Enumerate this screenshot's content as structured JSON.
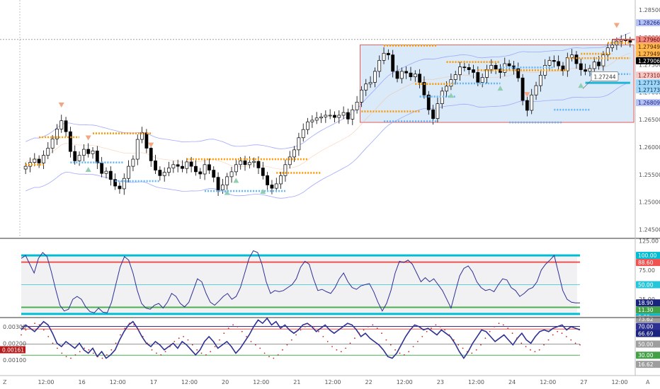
{
  "chart_data": [
    {
      "type": "candlestick",
      "panel": "price",
      "ylim": [
        1.2435,
        1.2868
      ],
      "y_ticks": [
        {
          "value": 1.285,
          "label": "1.28500"
        },
        {
          "value": 1.28,
          "label": "1.28000"
        },
        {
          "value": 1.275,
          "label": "1.27500"
        },
        {
          "value": 1.27,
          "label": "1.27000"
        },
        {
          "value": 1.265,
          "label": "1.26500"
        },
        {
          "value": 1.26,
          "label": "1.26000"
        },
        {
          "value": 1.255,
          "label": "1.25500"
        },
        {
          "value": 1.25,
          "label": "1.25000"
        },
        {
          "value": 1.245,
          "label": "1.24500"
        }
      ],
      "price_labels": [
        {
          "value": 1.28266,
          "label": "1.28266",
          "bg": "#b5c2f5",
          "fg": "#1a237e"
        },
        {
          "value": 1.2796,
          "label": "1.27960",
          "bg": "#f28b82",
          "fg": "#5a0000"
        },
        {
          "value": 1.27949,
          "label": "1.27949",
          "bg": "#ffb74d",
          "fg": "#4a2600"
        },
        {
          "value": 1.27949,
          "label": "1.27949",
          "bg": "#ffb74d",
          "fg": "#4a2600"
        },
        {
          "value": 1.27906,
          "label": "1.27906",
          "bg": "#000000",
          "fg": "#ffffff"
        },
        {
          "value": 1.2731,
          "label": "1.27310",
          "bg": "#f6c7c4",
          "fg": "#7a1010"
        },
        {
          "value": 1.27173,
          "label": "1.27173",
          "bg": "#9fd6f5",
          "fg": "#0d3b66"
        },
        {
          "value": 1.27173,
          "label": "1.27173",
          "bg": "#9fd6f5",
          "fg": "#0d3b66"
        },
        {
          "value": 1.26809,
          "label": "1.26809",
          "bg": "#b5c2f5",
          "fg": "#1a237e"
        }
      ],
      "annotation": {
        "label": "1.27244"
      },
      "rectangle": {
        "y_top": 1.2786,
        "y_bottom": 1.2645
      },
      "close": [
        1.2565,
        1.2572,
        1.2578,
        1.2571,
        1.2585,
        1.2598,
        1.2615,
        1.2633,
        1.2648,
        1.2628,
        1.2592,
        1.2575,
        1.2585,
        1.2596,
        1.2588,
        1.2593,
        1.2571,
        1.2552,
        1.2556,
        1.2541,
        1.2529,
        1.2524,
        1.2543,
        1.2565,
        1.2578,
        1.2614,
        1.2626,
        1.2598,
        1.2575,
        1.2558,
        1.2548,
        1.2554,
        1.2562,
        1.2568,
        1.2565,
        1.2561,
        1.2573,
        1.2565,
        1.2555,
        1.2551,
        1.2568,
        1.2558,
        1.2545,
        1.2522,
        1.2531,
        1.2546,
        1.2555,
        1.2568,
        1.2575,
        1.2568,
        1.2572,
        1.2574,
        1.2562,
        1.2548,
        1.2531,
        1.2525,
        1.2533,
        1.2548,
        1.2568,
        1.2582,
        1.2595,
        1.2617,
        1.2632,
        1.2646,
        1.2649,
        1.2653,
        1.2655,
        1.2658,
        1.2658,
        1.2654,
        1.2658,
        1.2663,
        1.2651,
        1.2668,
        1.2682,
        1.2704,
        1.2715,
        1.2718,
        1.2738,
        1.2758,
        1.2771,
        1.2768,
        1.2738,
        1.2725,
        1.2738,
        1.2735,
        1.2728,
        1.2733,
        1.2718,
        1.2695,
        1.2668,
        1.2652,
        1.2679,
        1.2702,
        1.2711,
        1.2723,
        1.2732,
        1.2746,
        1.2745,
        1.2741,
        1.2736,
        1.2718,
        1.2727,
        1.2741,
        1.2749,
        1.2742,
        1.2736,
        1.2752,
        1.2748,
        1.2743,
        1.2726,
        1.2685,
        1.2667,
        1.2695,
        1.2712,
        1.2731,
        1.2749,
        1.2758,
        1.2756,
        1.2748,
        1.2739,
        1.2763,
        1.2768,
        1.2752,
        1.2741,
        1.2738,
        1.2743,
        1.2755,
        1.2748,
        1.2768,
        1.2781,
        1.2786,
        1.2793,
        1.2795,
        1.2794,
        1.2791
      ]
    },
    {
      "type": "line",
      "panel": "oscillator-1",
      "ylim": [
        -5,
        128
      ],
      "y_ticks": [
        {
          "value": 125,
          "label": "125.00"
        },
        {
          "value": 75,
          "label": "75.00"
        },
        {
          "value": 50,
          "label": "50.00"
        },
        {
          "value": 25,
          "label": "25.00"
        },
        {
          "value": 0,
          "label": "0.00"
        }
      ],
      "levels": [
        {
          "value": 100,
          "color": "#00bcd4"
        },
        {
          "value": 88.6,
          "color": "#ef5350"
        },
        {
          "value": 50,
          "color": "#26c6da"
        },
        {
          "value": 11.3,
          "color": "#4caf50"
        },
        {
          "value": 0,
          "color": "#00bcd4"
        }
      ],
      "labels": [
        {
          "value": 100,
          "label": "100.00",
          "bg": "#00bcd4",
          "fg": "#ffffff"
        },
        {
          "value": 88.6,
          "label": "88.60",
          "bg": "#ef5350",
          "fg": "#ffffff"
        },
        {
          "value": 50,
          "label": "50.00",
          "bg": "#26c6da",
          "fg": "#ffffff"
        },
        {
          "value": 18.9,
          "label": "18.90",
          "bg": "#1a237e",
          "fg": "#ffffff"
        },
        {
          "value": 11.3,
          "label": "11.30",
          "bg": "#43a047",
          "fg": "#ffffff"
        },
        {
          "value": 0,
          "label": "0.00",
          "bg": "#00bcd4",
          "fg": "#ffffff"
        }
      ],
      "values": [
        95,
        100,
        85,
        70,
        95,
        105,
        98,
        72,
        42,
        15,
        5,
        8,
        25,
        30,
        25,
        12,
        4,
        2,
        10,
        3,
        2,
        20,
        50,
        80,
        98,
        92,
        70,
        40,
        18,
        10,
        8,
        15,
        18,
        10,
        20,
        35,
        30,
        18,
        12,
        20,
        40,
        60,
        55,
        35,
        20,
        15,
        22,
        30,
        35,
        25,
        30,
        45,
        70,
        95,
        108,
        105,
        85,
        55,
        35,
        40,
        38,
        40,
        45,
        50,
        60,
        80,
        90,
        85,
        60,
        40,
        42,
        38,
        35,
        45,
        60,
        70,
        55,
        45,
        42,
        48,
        50,
        52,
        38,
        20,
        5,
        18,
        40,
        70,
        90,
        88,
        92,
        85,
        70,
        55,
        62,
        55,
        60,
        50,
        40,
        25,
        10,
        38,
        65,
        78,
        82,
        72,
        55,
        45,
        40,
        42,
        38,
        50,
        60,
        58,
        45,
        40,
        30,
        35,
        42,
        45,
        55,
        75,
        85,
        92,
        100,
        70,
        40,
        25,
        20,
        19,
        18.9
      ]
    },
    {
      "type": "line",
      "panel": "oscillator-2",
      "ylim": [
        0.0001,
        0.0035
      ],
      "y_ticks": [
        {
          "value": 0.003,
          "label": "0.00300"
        },
        {
          "value": 0.002,
          "label": "0.00200"
        },
        {
          "value": 0.001,
          "label": "0.00100"
        }
      ],
      "tag": {
        "value": 0.00161,
        "label": "0.00161"
      },
      "levels": [
        {
          "value": 0.00301,
          "color": "#2e3192"
        },
        {
          "value": 0.00285,
          "color": "#ef5350"
        },
        {
          "value": 0.00195,
          "color": "#999999"
        },
        {
          "value": 0.00128,
          "color": "#4caf50"
        }
      ],
      "labels": [
        {
          "value": 0.00345,
          "label": "73.62",
          "bg": "#9e9e9e",
          "fg": "#ffffff"
        },
        {
          "value": 0.00301,
          "label": "70.00",
          "bg": "#2e3192",
          "fg": "#ffffff"
        },
        {
          "value": 0.00275,
          "label": "66.69",
          "bg": "#1a237e",
          "fg": "#ffffff"
        },
        {
          "value": 0.00195,
          "label": "50.00",
          "bg": "#9e9e9e",
          "fg": "#ffffff"
        },
        {
          "value": 0.00128,
          "label": "30.00",
          "bg": "#43a047",
          "fg": "#ffffff"
        },
        {
          "value": 0.00073,
          "label": "16.62",
          "bg": "#9e9e9e",
          "fg": "#ffffff"
        }
      ],
      "series": [
        {
          "values": [
            0.0028,
            0.0031,
            0.0029,
            0.0027,
            0.003,
            0.0033,
            0.0031,
            0.0026,
            0.002,
            0.0018,
            0.0021,
            0.0019,
            0.0017,
            0.002,
            0.0016,
            0.0014,
            0.0017,
            0.0012,
            0.0015,
            0.0011,
            0.0013,
            0.0016,
            0.0022,
            0.0027,
            0.0031,
            0.0033,
            0.0029,
            0.0024,
            0.002,
            0.0018,
            0.0021,
            0.0019,
            0.0016,
            0.0018,
            0.002,
            0.0017,
            0.0021,
            0.0019,
            0.0016,
            0.0013,
            0.0016,
            0.0021,
            0.0024,
            0.0021,
            0.0017,
            0.0019,
            0.0021,
            0.0018,
            0.0014,
            0.0017,
            0.0021,
            0.0025,
            0.003,
            0.0034,
            0.0032,
            0.0035,
            0.0031,
            0.0033,
            0.0029,
            0.0031,
            0.0028,
            0.0026,
            0.0028,
            0.0031,
            0.0032,
            0.003,
            0.0027,
            0.0029,
            0.0031,
            0.0028,
            0.0026,
            0.0028,
            0.003,
            0.0032,
            0.0031,
            0.0028,
            0.0024,
            0.0026,
            0.0023,
            0.0021,
            0.0019,
            0.0016,
            0.0012,
            0.0011,
            0.0014,
            0.0019,
            0.0024,
            0.0028,
            0.0031,
            0.003,
            0.0028,
            0.0029,
            0.0027,
            0.0025,
            0.0028,
            0.0026,
            0.0024,
            0.002,
            0.0015,
            0.0011,
            0.0015,
            0.002,
            0.0024,
            0.0028,
            0.0027,
            0.0024,
            0.0021,
            0.0023,
            0.0025,
            0.0022,
            0.0019,
            0.0023,
            0.0026,
            0.0022,
            0.002,
            0.0024,
            0.0027,
            0.0028,
            0.0027,
            0.0029,
            0.003,
            0.0031,
            0.0028,
            0.003,
            0.0029,
            0.0028
          ],
          "color": "#2e3192"
        },
        {
          "values": [
            0.0025,
            0.0028,
            0.003,
            0.0032,
            0.0031,
            0.0028,
            0.0024,
            0.002,
            0.0017,
            0.0014,
            0.0012,
            0.0011,
            0.0013,
            0.0015,
            0.0017,
            0.0016,
            0.0014,
            0.0012,
            0.0011,
            0.0013,
            0.0016,
            0.002,
            0.0025,
            0.0029,
            0.0032,
            0.0031,
            0.0028,
            0.0024,
            0.002,
            0.0016,
            0.0014,
            0.0013,
            0.0015,
            0.0018,
            0.0021,
            0.0023,
            0.0024,
            0.0022,
            0.0019,
            0.0016,
            0.0014,
            0.0013,
            0.0015,
            0.0018,
            0.0022,
            0.0026,
            0.0029,
            0.0031,
            0.003,
            0.0027,
            0.0024,
            0.0021,
            0.0019,
            0.0017,
            0.0014,
            0.0012,
            0.0011,
            0.0013,
            0.0016,
            0.0019,
            0.0022,
            0.0025,
            0.0028,
            0.003,
            0.0031,
            0.003,
            0.0027,
            0.0024,
            0.0021,
            0.0018,
            0.0016,
            0.0015,
            0.0017,
            0.002,
            0.0023,
            0.0026,
            0.0028,
            0.003,
            0.0031,
            0.0029,
            0.0026,
            0.0022,
            0.0019,
            0.0016,
            0.0014,
            0.0013,
            0.0015,
            0.0018,
            0.0021,
            0.0024,
            0.0027,
            0.0029,
            0.0031,
            0.003,
            0.0028,
            0.0025,
            0.0022,
            0.0019,
            0.0017,
            0.0015,
            0.0014,
            0.0016,
            0.0019,
            0.0023,
            0.0027,
            0.003,
            0.0032,
            0.0031,
            0.0029,
            0.0026,
            0.0023,
            0.002,
            0.0018,
            0.0016,
            0.0015,
            0.0016,
            0.0019,
            0.0022,
            0.0025,
            0.0027,
            0.0026,
            0.0024,
            0.0022,
            0.002,
            0.0019
          ],
          "color": "#c62828"
        }
      ]
    }
  ],
  "x_axis": [
    "12:00",
    "16",
    "12:00",
    "17",
    "12:00",
    "20",
    "12:00",
    "21",
    "12:00",
    "22",
    "12:00",
    "23",
    "12:00",
    "24",
    "12:00",
    "27",
    "12:00"
  ],
  "corners": {
    "bottom_left": "Z",
    "bottom_right": "A"
  },
  "colors": {
    "rect_fill": "#cfe3f5",
    "rect_stroke": "#e53935",
    "orange": "#ff9800",
    "light_blue": "#64b5f6",
    "band": "#9fa8ff",
    "up": "#ffffff",
    "down": "#000000"
  }
}
